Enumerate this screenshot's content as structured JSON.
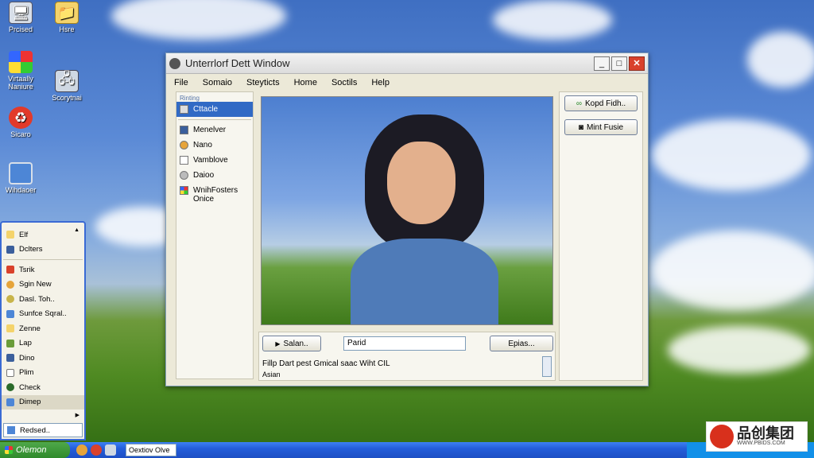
{
  "desktop_icons": [
    {
      "label": "Prcised",
      "icon": "computer-icon"
    },
    {
      "label": "Hsre",
      "icon": "folder-icon"
    },
    {
      "label": "Virtaally Naniure",
      "icon": "windows-icon"
    },
    {
      "label": "Scorytnai",
      "icon": "network-icon"
    },
    {
      "label": "Sicaro",
      "icon": "recycle-icon"
    },
    {
      "label": "Wihdaoer",
      "icon": "monitor-icon"
    }
  ],
  "window": {
    "title": "Unterrlorf Dett Window",
    "menu": [
      "File",
      "Somaio",
      "Steyticts",
      "Home",
      "Soctils",
      "Help"
    ],
    "left_panel": {
      "header": "Rinting",
      "items": [
        {
          "label": "Cttacle",
          "selected": true
        },
        {
          "label": "Menelver"
        },
        {
          "label": "Nano"
        },
        {
          "label": "Vamblove"
        },
        {
          "label": "Daioo"
        },
        {
          "label": "WnihFosters Onice"
        }
      ]
    },
    "right_panel": {
      "buttons": [
        "Kopd Fidh..",
        "Mint Fusie"
      ]
    },
    "bottom": {
      "left_button": "Salan..",
      "field_value": "Parid",
      "right_button": "Epias...",
      "status_line1": "Fillp Dart pest Gmical saac Wiht CIL",
      "status_line2": "Asian"
    }
  },
  "start_menu": {
    "items": [
      "Elf",
      "Dclters",
      "Tsrik",
      "Sgin New",
      "Dasl. Toh..",
      "Sunfce Sqral..",
      "Zenne",
      "Lap",
      "Dino",
      "Plim",
      "Check",
      "Dimep"
    ],
    "bottom_item": "Redsed.."
  },
  "taskbar": {
    "start_label": "Olemon",
    "task_item": "Oextiov Olve"
  },
  "watermark": {
    "brand": "品创集团",
    "url": "WWW.PBIDS.COM"
  }
}
